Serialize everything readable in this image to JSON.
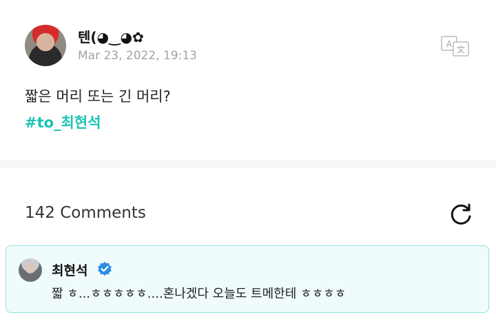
{
  "post": {
    "author": "텐(◕‿◕✿",
    "date": "Mar 23, 2022, 19:13",
    "text": "짧은 머리 또는 긴 머리?",
    "hashtag": "#to_최현석",
    "translate_icon": "translate-icon"
  },
  "comments": {
    "count_label": "142 Comments",
    "refresh_icon": "refresh-icon",
    "items": [
      {
        "author": "최현석",
        "verified": true,
        "text": "짧 ㅎ...ㅎㅎㅎㅎㅎ....혼나겠다 오늘도 트메한테 ㅎㅎㅎㅎ"
      }
    ]
  },
  "colors": {
    "hashtag": "#1cc3b6",
    "verified": "#2f8de4",
    "highlight_border": "#8ee1dd",
    "highlight_bg": "#f0fbfb"
  }
}
